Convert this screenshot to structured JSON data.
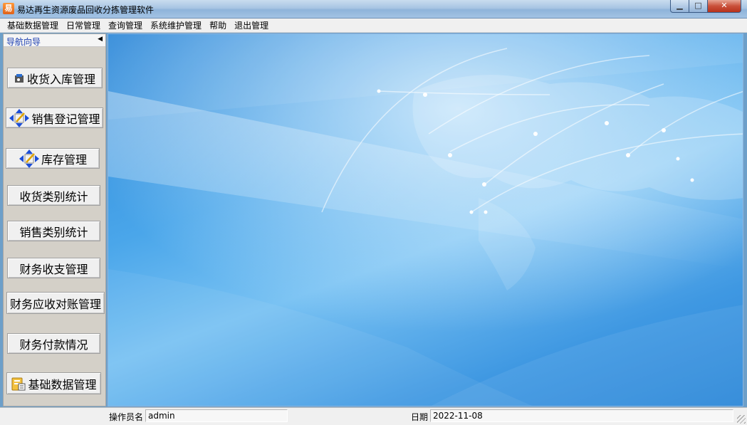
{
  "window": {
    "title": "易达再生资源废品回收分拣管理软件",
    "app_icon_glyph": "易",
    "controls": {
      "minimize": "▁",
      "maximize": "□",
      "close": "✕"
    }
  },
  "menu": [
    "基础数据管理",
    "日常管理",
    "查询管理",
    "系统维护管理",
    "帮助",
    "退出管理"
  ],
  "nav": {
    "header": "导航向导",
    "collapse_glyph": "◀",
    "buttons": [
      {
        "label": "收货入库管理",
        "icon": "receive-icon"
      },
      {
        "label": "销售登记管理",
        "icon": "edit-arrows-icon"
      },
      {
        "label": "库存管理",
        "icon": "edit-arrows-icon"
      },
      {
        "label": "收货类别统计",
        "icon": ""
      },
      {
        "label": "销售类别统计",
        "icon": ""
      },
      {
        "label": "财务收支管理",
        "icon": ""
      },
      {
        "label": "财务应收对账管理",
        "icon": ""
      },
      {
        "label": "财务付款情况",
        "icon": ""
      },
      {
        "label": "基础数据管理",
        "icon": "database-icon"
      }
    ]
  },
  "status": {
    "operator_label": "操作员名",
    "operator_value": "admin",
    "date_label": "日期",
    "date_value": "2022-11-08"
  },
  "colors": {
    "nav_header_text": "#1a3db0",
    "main_background": "#3f98e2",
    "close_button": "#c9503a"
  }
}
